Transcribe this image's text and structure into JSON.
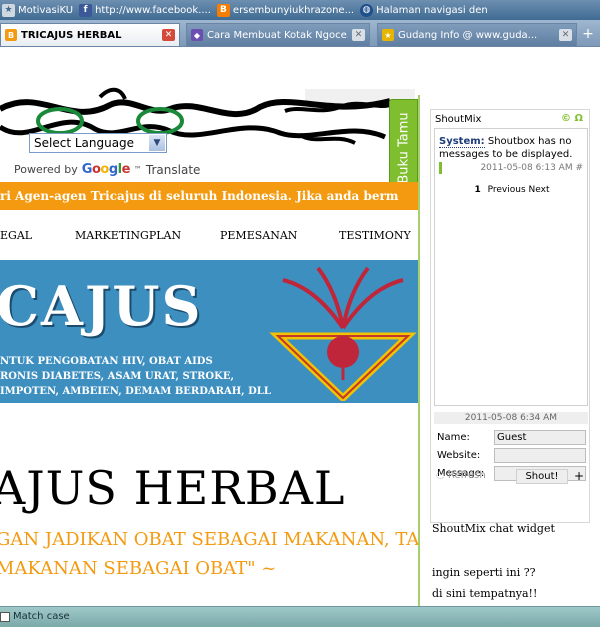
{
  "bookmarks": [
    {
      "label": "MotivasiKU",
      "icon": "bookmark-icon"
    },
    {
      "label": "http://www.facebook....",
      "icon": "facebook-icon"
    },
    {
      "label": "ersembunyiukhrazone...",
      "icon": "blogger-icon"
    },
    {
      "label": "Halaman navigasi den",
      "icon": "globe-icon"
    }
  ],
  "tabs": [
    {
      "label": "TRICAJUS HERBAL",
      "active": true
    },
    {
      "label": "Cara Membuat Kotak Ngoce...",
      "active": false
    },
    {
      "label": "Gudang Info @ www.guda...",
      "active": false
    }
  ],
  "new_tab_label": "+",
  "language": {
    "selected": "Select Language",
    "powered_by": "Powered by",
    "google": "Google",
    "tm": "™",
    "translate": "Translate"
  },
  "buku_tamu": "Buku Tamu",
  "ticker_text": "ri Agen-agen Tricajus di seluruh Indonesia. Jika anda berm",
  "nav_items": [
    "EGAL",
    "MARKETINGPLAN",
    "PEMESANAN",
    "TESTIMONY"
  ],
  "hero": {
    "title": "CAJUS",
    "lines": [
      "NTUK PENGOBATAN HIV, OBAT AIDS",
      "RONIS DIABETES, ASAM URAT, STROKE,",
      "IMPOTEN, AMBEIEN, DEMAM BERDARAH, DLL"
    ]
  },
  "site_title": "AJUS HERBAL",
  "slogan": [
    "GAN JADIKAN OBAT SEBAGAI MAKANAN, TA",
    "MAKANAN SEBAGAI OBAT\" ~"
  ],
  "shoutmix": {
    "title": "ShoutMix",
    "icons": "© Ω",
    "system_label": "System:",
    "system_msg": "Shoutbox has no messages to be displayed.",
    "msg_time": "2011-05-08 6:13 AM #",
    "page_current": "1",
    "prev": "Previous",
    "next": "Next",
    "stamp": "2011-05-08 6:34 AM",
    "name_label": "Name:",
    "name_value": "Guest",
    "website_label": "Website:",
    "message_label": "Message:",
    "refresh": "Refresh",
    "shout_btn": "Shout!",
    "plus_btn": "+"
  },
  "sidebar_texts": [
    "ShoutMix chat widget",
    "ingin seperti ini ??",
    "di sini tempatnya!!"
  ],
  "findbar": {
    "match_case": "Match case"
  },
  "colors": {
    "accent_orange": "#f39a10",
    "shout_green": "#7fbf2f",
    "hero_blue": "#3d8fc0"
  }
}
